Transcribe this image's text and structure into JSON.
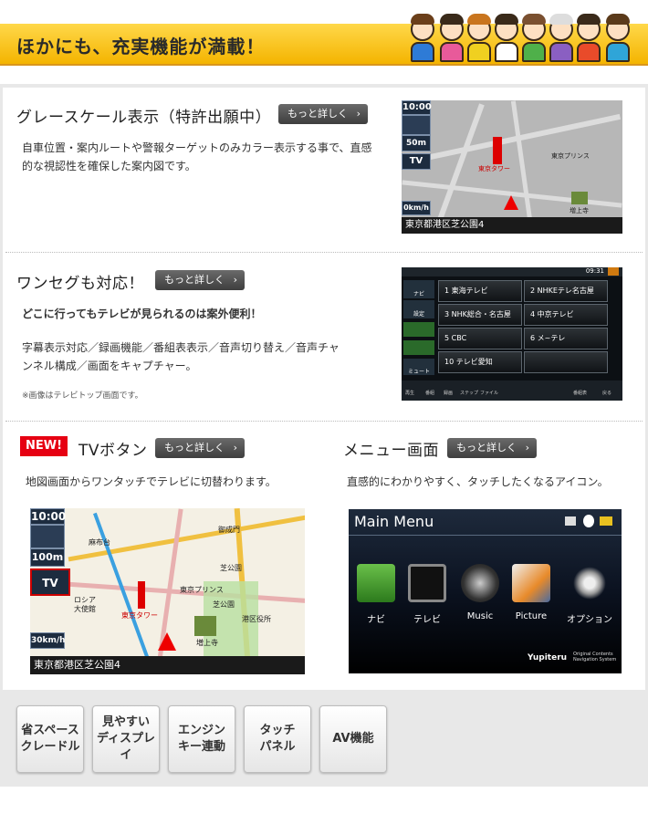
{
  "header": {
    "title": "ほかにも、充実機能が満載！"
  },
  "sections": {
    "grayscale": {
      "heading": "グレースケール表示（特許出願中）",
      "more": "もっと詳しく",
      "desc_line1": "自車位置・案内ルートや警報ターゲットのみカラー表示する事で、直感",
      "desc_line2": "的な視認性を確保した案内図です。",
      "screen": {
        "clock": "10:00",
        "scale": "50m",
        "tv": "TV",
        "speed": "0km/h",
        "address": "東京都港区芝公園4",
        "label_tower": "東京タワー",
        "label_hotel": "東京プリンス",
        "label_temple": "増上寺"
      }
    },
    "oneseg": {
      "heading": "ワンセグも対応！",
      "more": "もっと詳しく",
      "lead": "どこに行ってもテレビが見られるのは案外便利！",
      "desc_line1": "字幕表示対応／録画機能／番組表表示／音声切り替え／音声チャ",
      "desc_line2": "ンネル構成／画面をキャプチャー。",
      "note": "※画像はテレビトップ画面です。",
      "screen": {
        "time": "09:31",
        "channels": [
          "1 東海テレビ",
          "2 NHKEテレ名古屋",
          "3 NHK総合・名古屋",
          "4 中京テレビ",
          "5 CBC",
          "6 メ~テレ",
          "10 テレビ愛知",
          ""
        ],
        "side": [
          "ナビ",
          "設定",
          "ミュート"
        ],
        "bottom": [
          "再生",
          "番組",
          "録画",
          "ステップ",
          "ファイル",
          "番組表",
          "戻る"
        ]
      }
    },
    "tvbutton": {
      "badge": "NEW!",
      "heading": "TVボタン",
      "more": "もっと詳しく",
      "desc": "地図画面からワンタッチでテレビに切替わります。",
      "screen": {
        "clock": "10:00",
        "scale": "100m",
        "tv": "TV",
        "speed": "30km/h",
        "address": "東京都港区芝公園4",
        "labels": [
          "麻布台",
          "東京プリンス",
          "芝公園",
          "東京タワー",
          "増上寺",
          "港区役所",
          "ロシア大使館",
          "御成門",
          "芝公園"
        ]
      }
    },
    "menu": {
      "heading": "メニュー画面",
      "more": "もっと詳しく",
      "desc": "直感的にわかりやすく、タッチしたくなるアイコン。",
      "screen": {
        "title": "Main Menu",
        "items": [
          "ナビ",
          "テレビ",
          "Music",
          "Picture",
          "オプション"
        ],
        "brand": "Yupiteru",
        "brand_sub1": "Original Contents",
        "brand_sub2": "Navigation System"
      }
    }
  },
  "features": [
    {
      "label": "省スペース\nクレードル"
    },
    {
      "label": "見やすい\nディスプレイ"
    },
    {
      "label": "エンジン\nキー連動"
    },
    {
      "label": "タッチ\nパネル"
    },
    {
      "label": "AV機能"
    }
  ],
  "colors": {
    "banner": "#f4b400",
    "new_badge": "#e60012",
    "button": "#4a4a4a"
  }
}
